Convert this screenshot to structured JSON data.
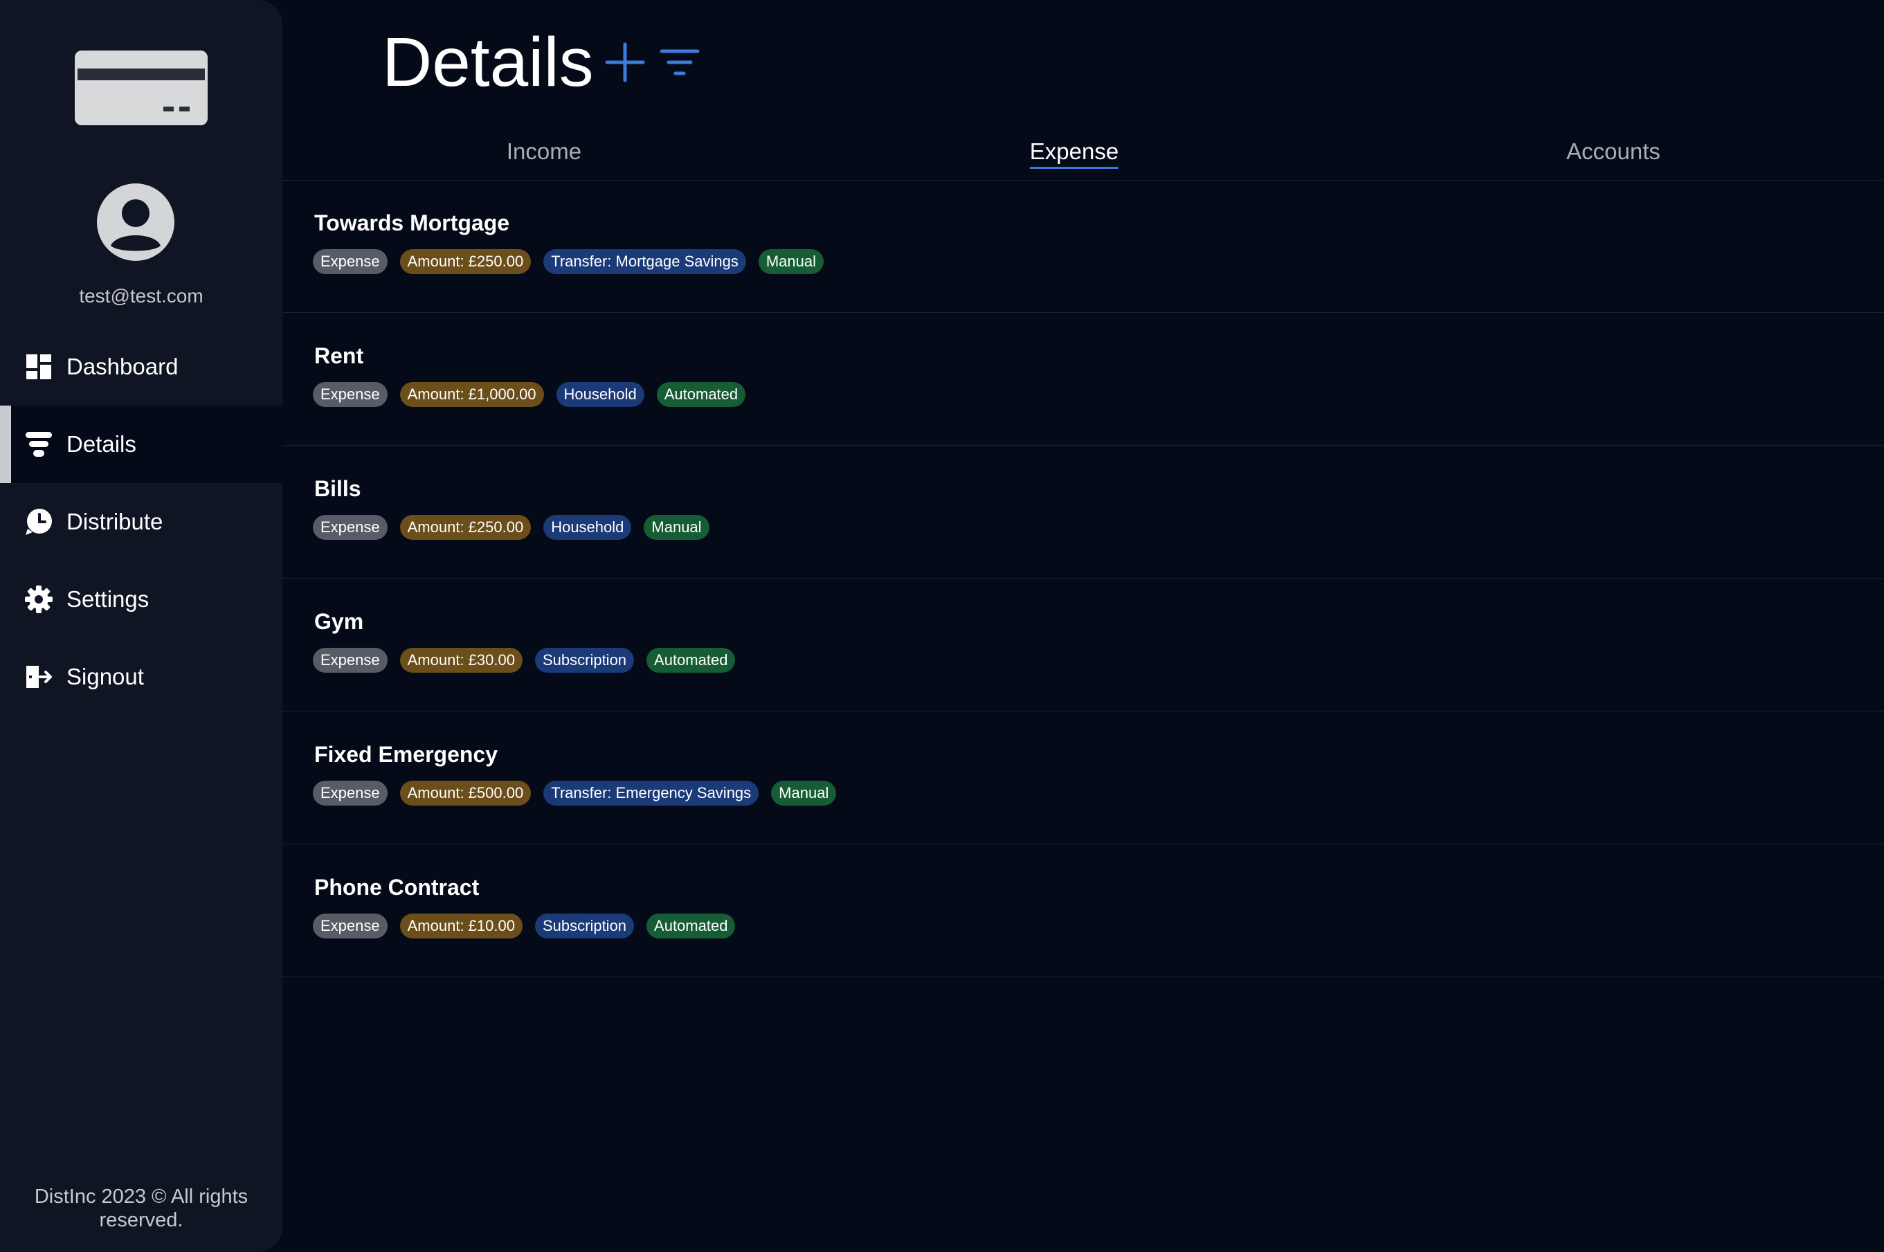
{
  "sidebar": {
    "logo_icon": "credit-card-icon",
    "user_email": "test@test.com",
    "items": [
      {
        "label": "Dashboard",
        "icon": "dashboard-icon",
        "active": false
      },
      {
        "label": "Details",
        "icon": "filter-icon",
        "active": true
      },
      {
        "label": "Distribute",
        "icon": "pie-chart-icon",
        "active": false
      },
      {
        "label": "Settings",
        "icon": "gear-icon",
        "active": false
      },
      {
        "label": "Signout",
        "icon": "signout-icon",
        "active": false
      }
    ],
    "footer": "DistInc 2023 © All rights reserved."
  },
  "header": {
    "title": "Details",
    "add_icon": "plus-icon",
    "filter_icon": "filter-lines-icon"
  },
  "tabs": [
    {
      "label": "Income",
      "active": false
    },
    {
      "label": "Expense",
      "active": true
    },
    {
      "label": "Accounts",
      "active": false
    }
  ],
  "rows": [
    {
      "title": "Towards Mortgage",
      "type": "Expense",
      "amount": "Amount: £250.00",
      "category": "Transfer: Mortgage Savings",
      "mode": "Manual"
    },
    {
      "title": "Rent",
      "type": "Expense",
      "amount": "Amount: £1,000.00",
      "category": "Household",
      "mode": "Automated"
    },
    {
      "title": "Bills",
      "type": "Expense",
      "amount": "Amount: £250.00",
      "category": "Household",
      "mode": "Manual"
    },
    {
      "title": "Gym",
      "type": "Expense",
      "amount": "Amount: £30.00",
      "category": "Subscription",
      "mode": "Automated"
    },
    {
      "title": "Fixed Emergency",
      "type": "Expense",
      "amount": "Amount: £500.00",
      "category": "Transfer: Emergency Savings",
      "mode": "Manual"
    },
    {
      "title": "Phone Contract",
      "type": "Expense",
      "amount": "Amount: £10.00",
      "category": "Subscription",
      "mode": "Automated"
    }
  ],
  "colors": {
    "background": "#040a18",
    "sidebar": "#0f1522",
    "accent": "#3d7bd8",
    "badge_type": "#575c66",
    "badge_amount": "#6b4e1a",
    "badge_category": "#1b3a78",
    "badge_mode": "#165c34"
  }
}
